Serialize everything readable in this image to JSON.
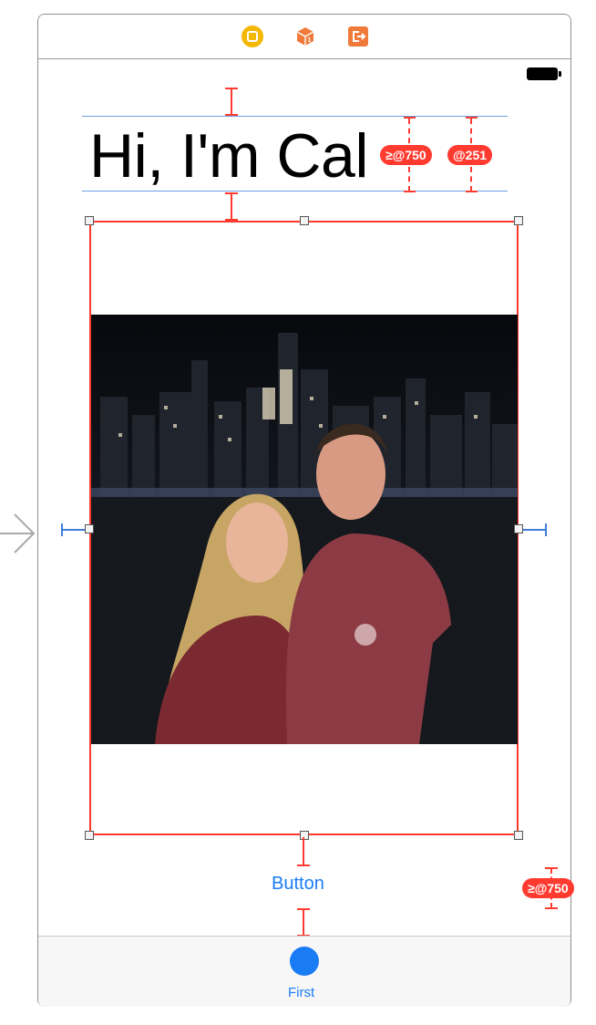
{
  "title_label": "Hi, I'm Cal",
  "button_label": "Button",
  "tab_item_label": "First",
  "constraint_badges": {
    "title_right_1": "≥@750",
    "title_right_2": "@251",
    "button_bottom": "≥@750"
  },
  "dock_icons": [
    "view-controller-icon",
    "first-responder-icon",
    "exit-icon"
  ],
  "colors": {
    "constraint": "#ff3b30",
    "guide": "#6c9ee0",
    "tint": "#1a7cf5",
    "view_controller_icon": "#f5b800",
    "first_responder_icon": "#f07a3a",
    "exit_icon": "#f07a3a"
  }
}
